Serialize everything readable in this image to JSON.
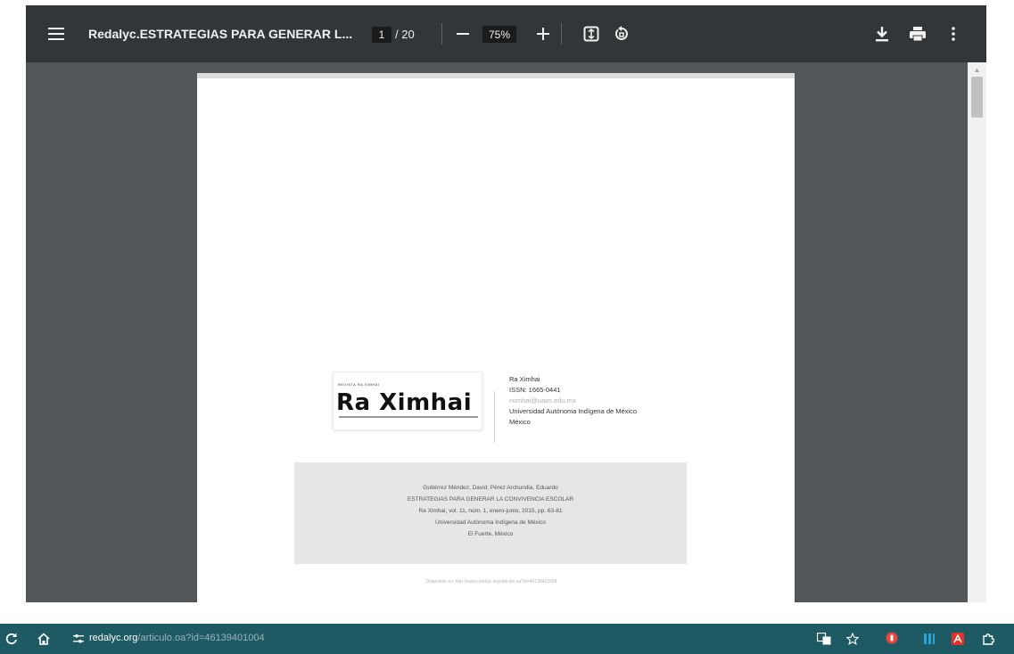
{
  "toolbar": {
    "document_title": "Redalyc.ESTRATEGIAS PARA GENERAR L...",
    "current_page": "1",
    "page_total": "/ 20",
    "zoom": "75%"
  },
  "pdf_page": {
    "logo": {
      "kicker": "REVISTA RA XIMHAI",
      "name": "Ra Ximhai"
    },
    "journal_info": {
      "title": "Ra Ximhai",
      "issn": "ISSN: 1665-0441",
      "email": "rximhai@uaim.edu.mx",
      "institution": "Universidad Autónoma Indígena de México",
      "country": "México"
    },
    "citation": {
      "authors": "Gutiérrez Méndez, David; Pérez Archundia, Eduardo",
      "title": "ESTRATEGIAS PARA GENERAR LA CONVIVENCIA ESCOLAR",
      "journal_ref": "Ra Ximhai, vol. 11, núm. 1, enero-junio, 2015, pp. 63-81",
      "publisher": "Universidad Autónoma Indígena de México",
      "place": "El Fuerte, México"
    },
    "available": "Disponible en: http://www.redalyc.org/articulo.oa?id=46139401004"
  },
  "browser_bar": {
    "url_domain": "redalyc.org",
    "url_path": "/articulo.oa?id=46139401004"
  },
  "colors": {
    "viewer_bg": "#525659",
    "toolbar_bg": "#323639",
    "bottom_bar_bg": "#1e5a63",
    "citation_bg": "#e6e6e6"
  },
  "icons": {
    "menu": "menu-icon",
    "zoom_out": "minus-icon",
    "zoom_in": "plus-icon",
    "fit": "fit-to-page-icon",
    "rotate": "rotate-icon",
    "download": "download-icon",
    "print": "print-icon",
    "more": "more-vert-icon",
    "reload": "reload-icon",
    "home": "home-icon",
    "site_info": "tune-icon",
    "translate": "translate-icon",
    "bookmark": "star-icon"
  }
}
